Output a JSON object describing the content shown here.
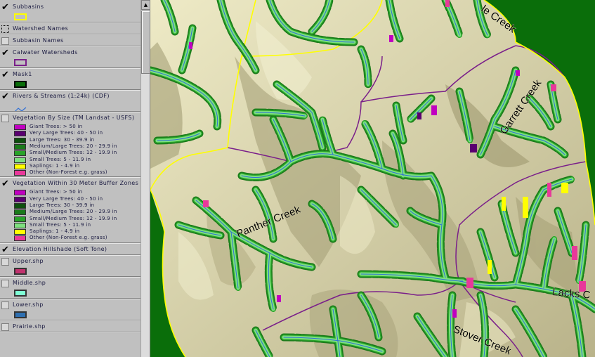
{
  "toc": {
    "layers": [
      {
        "id": "subbasins",
        "name": "Subbasins",
        "checked": true,
        "symbol": "poly",
        "fill": "none",
        "outline": "#ffff00"
      },
      {
        "id": "watershed_names",
        "name": "Watershed Names",
        "checked": false,
        "checkbox_style": "dotted"
      },
      {
        "id": "subbasin_names",
        "name": "Subbasin Names",
        "checked": false
      },
      {
        "id": "calwater",
        "name": "Calwater Watersheds",
        "checked": true,
        "symbol": "poly",
        "fill": "none",
        "outline": "#7a1f8a"
      },
      {
        "id": "mask1",
        "name": "Mask1",
        "checked": true,
        "symbol": "poly",
        "fill": "#0a6e0a",
        "outline": "#000"
      },
      {
        "id": "rivers",
        "name": "Rivers & Streams (1:24k) (CDF)",
        "checked": true,
        "symbol": "line",
        "outline": "#2f6fd6"
      },
      {
        "id": "veg_size",
        "name": "Vegetation By Size (TM Landsat - USFS)",
        "checked": false,
        "classes": [
          {
            "label": "Giant Trees: > 50 in",
            "color": "#c000c0"
          },
          {
            "label": "Very Large Trees: 40 - 50 in",
            "color": "#5a0070"
          },
          {
            "label": "Large Trees: 30 - 39.9 in",
            "color": "#0d4f0d"
          },
          {
            "label": "Medium/Large Trees: 20 - 29.9 in",
            "color": "#1a7a1a"
          },
          {
            "label": "Small/Medium Trees: 12 - 19.9 in",
            "color": "#29a329"
          },
          {
            "label": "Small Trees: 5 - 11.9 in",
            "color": "#7ee07e"
          },
          {
            "label": "Saplings: 1 - 4.9 in",
            "color": "#ffff00"
          },
          {
            "label": "Other (Non-Forest e.g. grass)",
            "color": "#e8389a"
          }
        ]
      },
      {
        "id": "veg_buffer",
        "name": "Vegetation Within 30 Meter Buffer Zones",
        "checked": true,
        "classes": [
          {
            "label": "Giant Trees: > 50 in",
            "color": "#c000c0"
          },
          {
            "label": "Very Large Trees: 40 - 50 in",
            "color": "#5a0070"
          },
          {
            "label": "Large Trees: 30 - 39.9 in",
            "color": "#0d4f0d"
          },
          {
            "label": "Medium/Large Trees: 20 - 29.9 in",
            "color": "#1a7a1a"
          },
          {
            "label": "Small/Medium Trees: 12 - 19.9 in",
            "color": "#29a329"
          },
          {
            "label": "Small Trees: 5 - 11.9 in",
            "color": "#7ee07e"
          },
          {
            "label": "Saplings: 1 - 4.9 in",
            "color": "#ffff00"
          },
          {
            "label": "Other (Non-Forest e.g. grass)",
            "color": "#e8389a"
          }
        ]
      },
      {
        "id": "hillshade",
        "name": "Elevation Hillshade (Soft Tone)",
        "checked": true
      },
      {
        "id": "upper",
        "name": "Upper.shp",
        "checked": false,
        "symbol": "poly",
        "fill": "#c2326e",
        "outline": "#333"
      },
      {
        "id": "middle",
        "name": "Middle.shp",
        "checked": false,
        "symbol": "poly",
        "fill": "#7fffd4",
        "outline": "#333"
      },
      {
        "id": "lower",
        "name": "Lower.shp",
        "checked": false,
        "symbol": "poly",
        "fill": "#2e6fb0",
        "outline": "#333"
      },
      {
        "id": "prairie",
        "name": "Prairie.shp",
        "checked": false
      }
    ]
  },
  "map": {
    "labels": [
      {
        "id": "creek-top",
        "text": "le Creek"
      },
      {
        "id": "garrett",
        "text": "Garrett Creek"
      },
      {
        "id": "panther",
        "text": "Panther Creek"
      },
      {
        "id": "lacks",
        "text": "Lacks C"
      },
      {
        "id": "stover",
        "text": "Stover Creek"
      }
    ],
    "colors": {
      "mask": "#0a6e0a",
      "terrain": "#d8d4a8",
      "subbasin_outline": "#ffff00",
      "watershed_outline": "#7a1f8a",
      "stream": "#2f6fd6",
      "buffer_light": "#7ee07e",
      "buffer_mid": "#29a329",
      "buffer_dark": "#1a7a1a"
    }
  }
}
